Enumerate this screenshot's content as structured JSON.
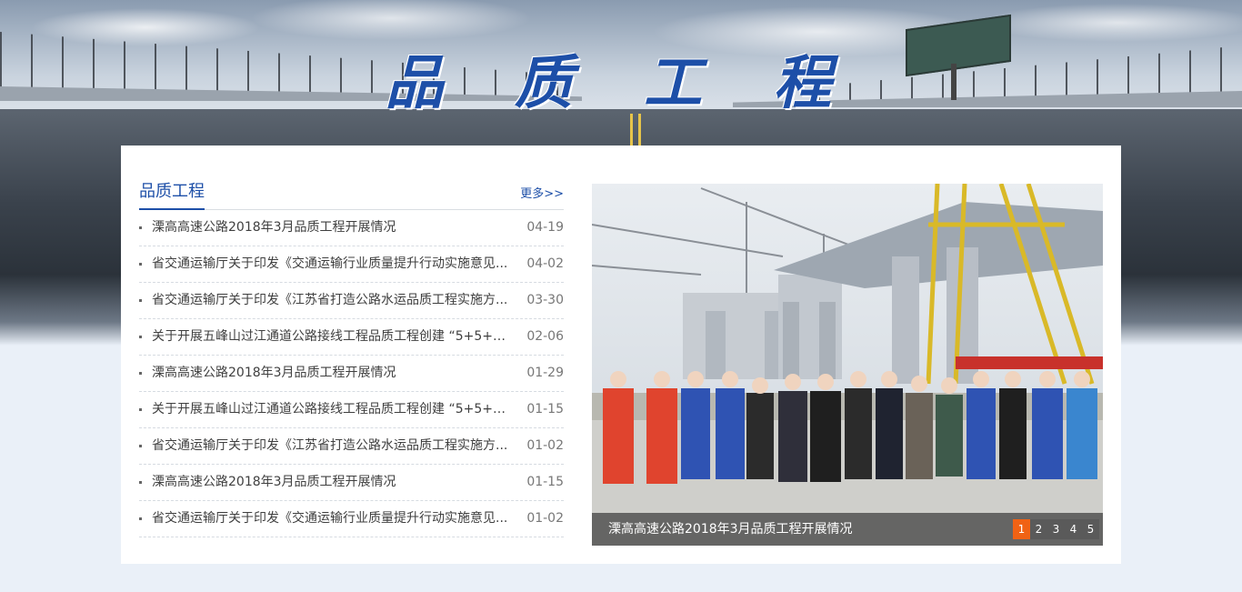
{
  "banner": {
    "title": "品 质 工 程"
  },
  "section": {
    "title": "品质工程",
    "more_label": "更多>>"
  },
  "news": [
    {
      "title": "溧高高速公路2018年3月品质工程开展情况",
      "date": "04-19"
    },
    {
      "title": "省交通运输厅关于印发《交通运输行业质量提升行动实施意见...",
      "date": "04-02"
    },
    {
      "title": "省交通运输厅关于印发《江苏省打造公路水运品质工程实施方...",
      "date": "03-30"
    },
    {
      "title": "关于开展五峰山过江通道公路接线工程品质工程创建 “5+5+5...",
      "date": "02-06"
    },
    {
      "title": "溧高高速公路2018年3月品质工程开展情况",
      "date": "01-29"
    },
    {
      "title": "关于开展五峰山过江通道公路接线工程品质工程创建 “5+5+5...",
      "date": "01-15"
    },
    {
      "title": "省交通运输厅关于印发《江苏省打造公路水运品质工程实施方...",
      "date": "01-02"
    },
    {
      "title": "溧高高速公路2018年3月品质工程开展情况",
      "date": "01-15"
    },
    {
      "title": "省交通运输厅关于印发《交通运输行业质量提升行动实施意见...",
      "date": "01-02"
    }
  ],
  "slider": {
    "caption": "溧高高速公路2018年3月品质工程开展情况",
    "pages": [
      "1",
      "2",
      "3",
      "4",
      "5"
    ],
    "active_page": "1",
    "accent_color": "#f06214"
  },
  "colors": {
    "brand": "#1d4fa8",
    "background": "#eaf0f8"
  }
}
